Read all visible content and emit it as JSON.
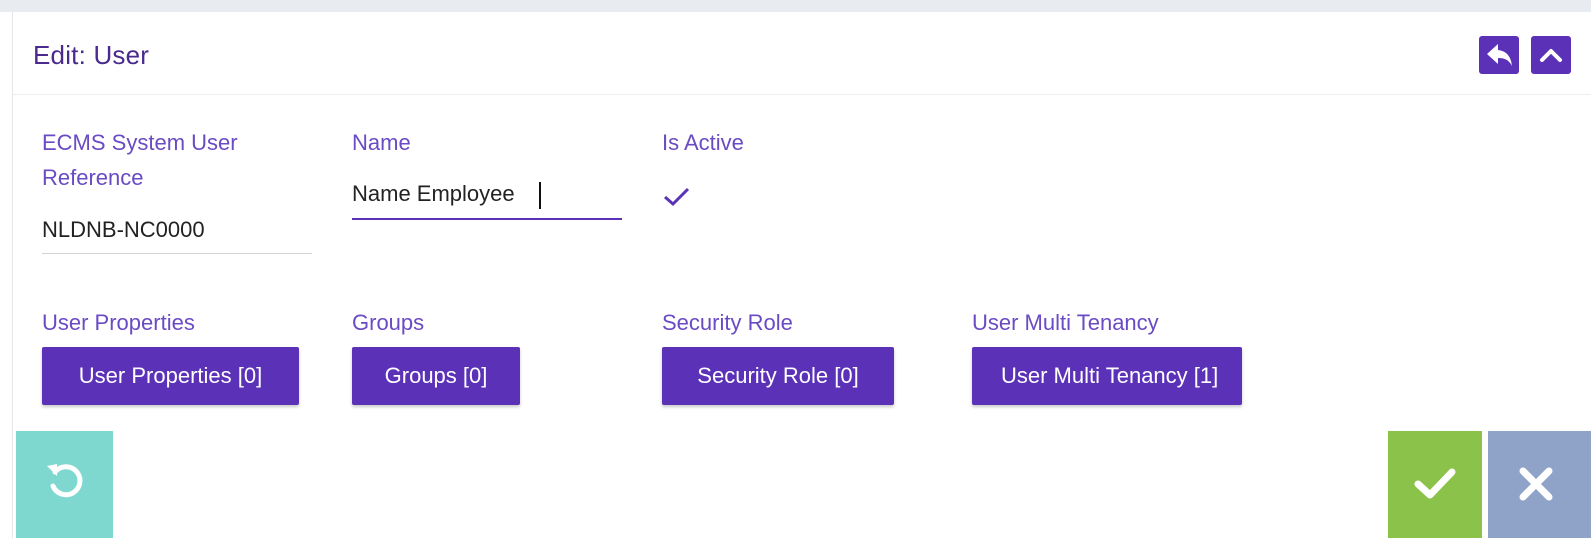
{
  "colors": {
    "accent": "#5b31b8",
    "label": "#6a4bc4",
    "reset_button": "#7fd8cf",
    "save_button": "#8bc34a",
    "cancel_button": "#8fa3c9"
  },
  "header": {
    "title": "Edit: User",
    "icons": [
      "reply-icon",
      "chevron-up-icon"
    ]
  },
  "fields": {
    "reference": {
      "label_line1": "ECMS System User",
      "label_line2": "Reference",
      "value": "NLDNB-NC0000"
    },
    "name": {
      "label": "Name",
      "value": "Name Employee"
    },
    "is_active": {
      "label": "Is Active",
      "checked": true
    }
  },
  "related": {
    "user_properties": {
      "label": "User Properties",
      "button": "User Properties [0]"
    },
    "groups": {
      "label": "Groups",
      "button": "Groups [0]"
    },
    "security_role": {
      "label": "Security Role",
      "button": "Security Role [0]"
    },
    "multi_tenancy": {
      "label": "User Multi Tenancy",
      "button": "User Multi Tenancy [1]"
    }
  },
  "footer": {
    "icons": [
      "reset-icon",
      "check-icon",
      "close-icon"
    ]
  }
}
